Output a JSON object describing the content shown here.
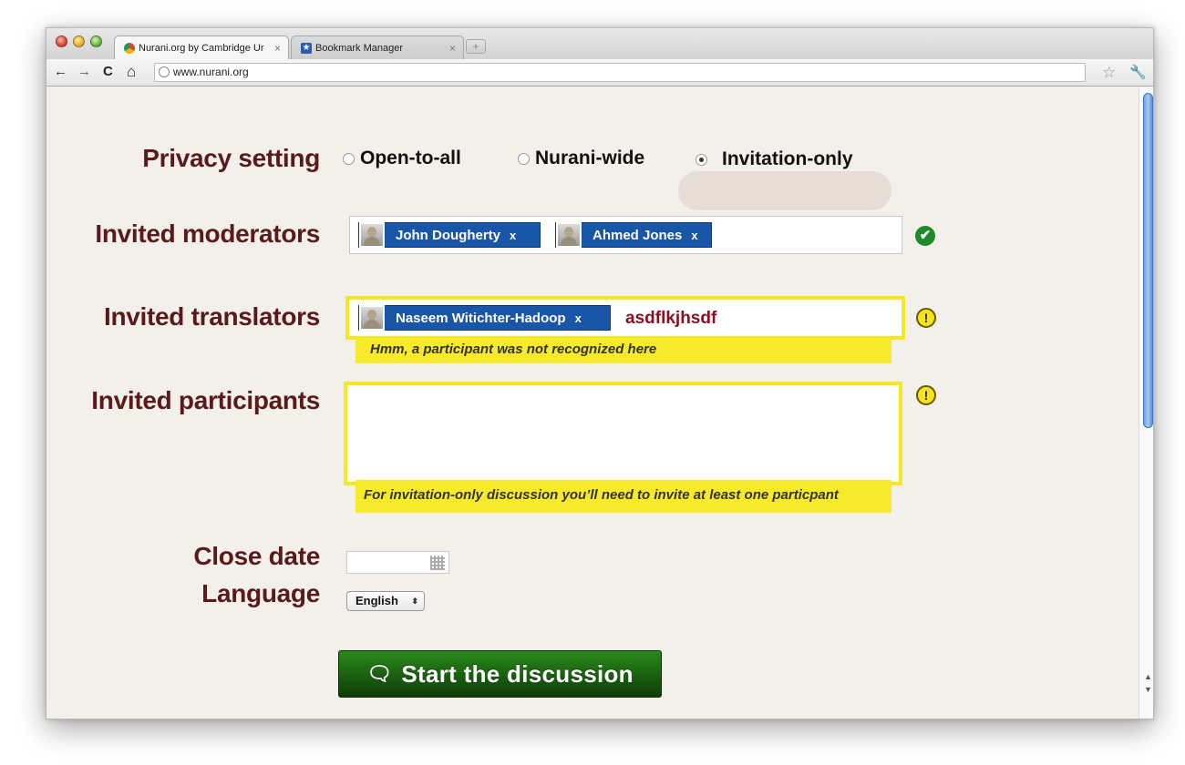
{
  "browser": {
    "tabs": [
      {
        "label": "Nurani.org  by Cambridge Ur",
        "close": "×"
      },
      {
        "label": "Bookmark Manager",
        "close": "×"
      }
    ],
    "new_tab": "+",
    "url": "www.nurani.org",
    "back": "←",
    "forward": "→",
    "reload": "C",
    "home": "⌂",
    "star": "☆",
    "wrench": "🔧"
  },
  "form": {
    "privacy": {
      "label": "Privacy setting",
      "options": [
        "Open-to-all",
        "Nurani-wide",
        "Invitation-only"
      ],
      "selected": "Invitation-only"
    },
    "moderators": {
      "label": "Invited moderators",
      "tokens": [
        "John Dougherty",
        "Ahmed Jones"
      ],
      "remove": "x"
    },
    "translators": {
      "label": "Invited translators",
      "tokens": [
        "Naseem Witichter-Hadoop"
      ],
      "remove": "x",
      "typed_text": "asdflkjhsdf",
      "hint": "Hmm, a participant was not recognized here"
    },
    "participants": {
      "label": "Invited participants",
      "value": "",
      "hint": "For invitation-only discussion you’ll need to invite at least one particpant"
    },
    "close_date": {
      "label": "Close date",
      "value": ""
    },
    "language": {
      "label": "Language",
      "selected": "English"
    },
    "submit": "Start the discussion"
  },
  "icons": {
    "check": "✔",
    "warning": "!",
    "speech_bubble": "💬",
    "caret": "⬍"
  },
  "colors": {
    "label": "#5a1a1a",
    "token_bg": "#1a56a8",
    "warning_yellow": "#f5e81c",
    "button_green": "#1a5e10",
    "typed_text": "#8a1020"
  }
}
